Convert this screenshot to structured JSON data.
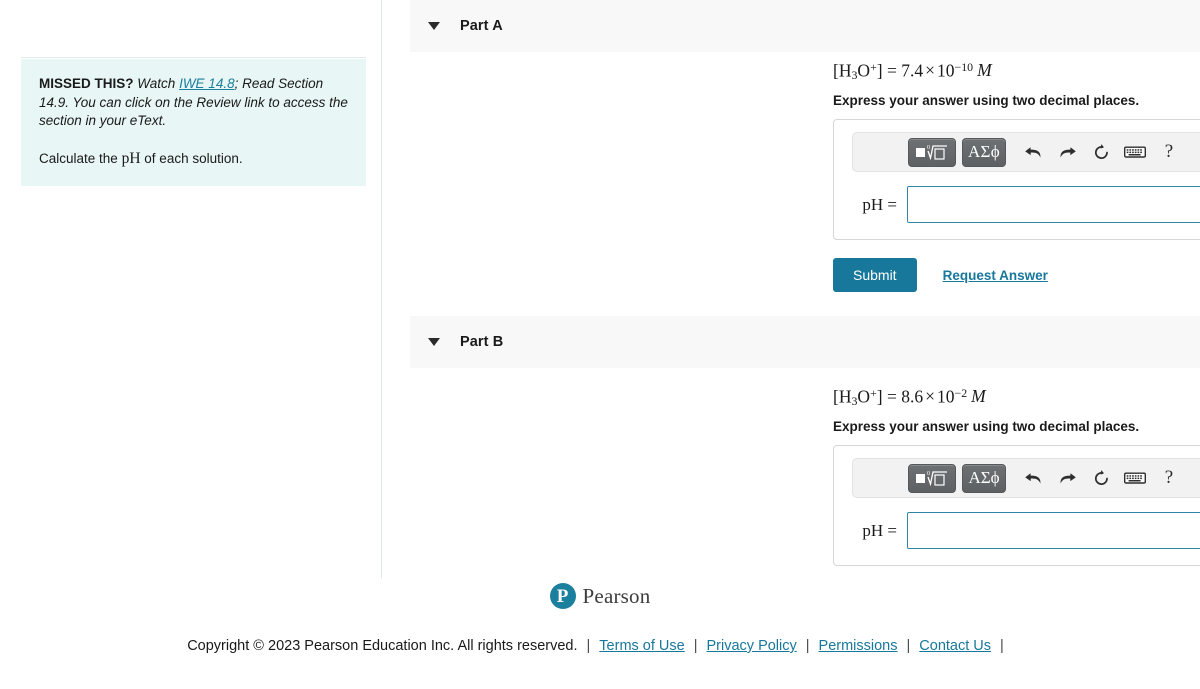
{
  "hint": {
    "missed_label": "MISSED THIS?",
    "watch_text": "Watch",
    "link_label": "IWE 14.8",
    "after_link": "; Read Section 14.9. You can click on the Review link to access the section in your eText.",
    "prompt_prefix": "Calculate the",
    "prompt_symbol": "pH",
    "prompt_suffix": "of each solution.",
    "background_color": "#e8f6f5",
    "link_color": "#1b7f9e"
  },
  "parts": [
    {
      "caret_icon": "caret-down-icon",
      "title": "Part A",
      "formula": {
        "species_open": "[H",
        "species_sub": "3",
        "species_mid": "O",
        "species_sup": "+",
        "species_close": "]",
        "equals": "=",
        "mantissa": "7.4",
        "times": "×",
        "base": "10",
        "exponent": "−10",
        "unit": "M"
      },
      "instruction": "Express your answer using two decimal places.",
      "toolbar": {
        "template_button": "math-template-button",
        "greek_button": "ΑΣϕ",
        "undo_icon": "undo-icon",
        "redo_icon": "redo-icon",
        "reset_icon": "reset-icon",
        "keyboard_icon": "keyboard-icon",
        "help_icon": "?"
      },
      "input_label": "pH =",
      "input_value": "",
      "input_placeholder": "",
      "submit_label": "Submit",
      "request_answer_label": "Request Answer",
      "has_submit": true
    },
    {
      "caret_icon": "caret-down-icon",
      "title": "Part B",
      "formula": {
        "species_open": "[H",
        "species_sub": "3",
        "species_mid": "O",
        "species_sup": "+",
        "species_close": "]",
        "equals": "=",
        "mantissa": "8.6",
        "times": "×",
        "base": "10",
        "exponent": "−2",
        "unit": "M"
      },
      "instruction": "Express your answer using two decimal places.",
      "toolbar": {
        "template_button": "math-template-button",
        "greek_button": "ΑΣϕ",
        "undo_icon": "undo-icon",
        "redo_icon": "redo-icon",
        "reset_icon": "reset-icon",
        "keyboard_icon": "keyboard-icon",
        "help_icon": "?"
      },
      "input_label": "pH =",
      "input_value": "",
      "input_placeholder": "",
      "submit_label": "Submit",
      "request_answer_label": "Request Answer",
      "has_submit": false
    }
  ],
  "footer": {
    "logo_mark": "P",
    "logo_word": "Pearson",
    "copyright": "Copyright © 2023 Pearson Education Inc. All rights reserved.",
    "separator": "|",
    "links": [
      "Terms of Use",
      "Privacy Policy",
      "Permissions",
      "Contact Us"
    ],
    "link_color": "#17789c"
  },
  "theme": {
    "submit_color": "#17789c",
    "input_border": "#2e87a8",
    "part_header_bg": "#f8f8f8"
  }
}
